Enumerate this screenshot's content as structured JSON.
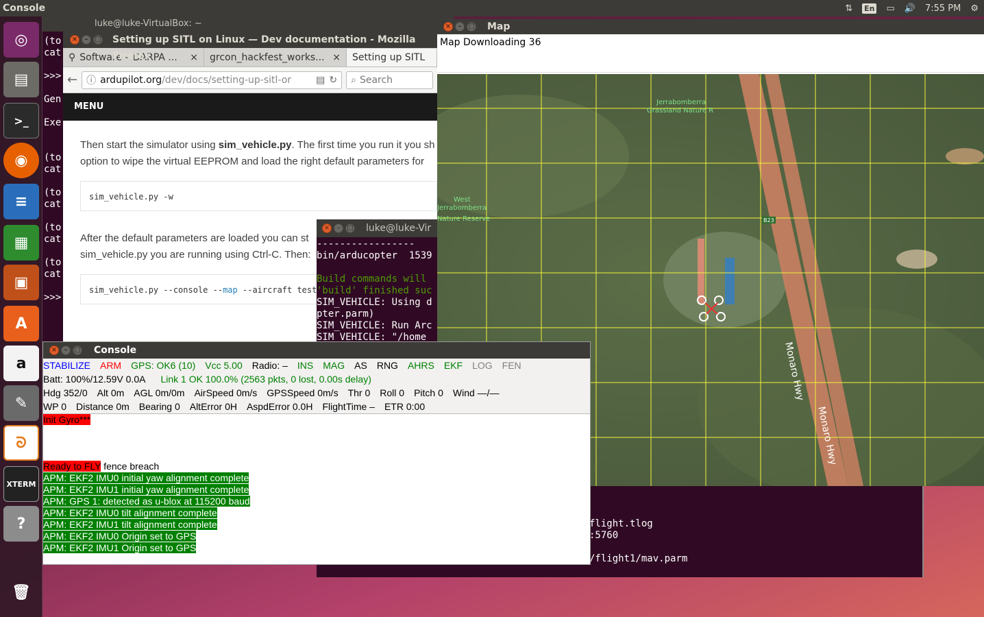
{
  "topbar": {
    "title": "Console",
    "lang": "En",
    "time": "7:55 PM"
  },
  "launcher": {
    "items": [
      "ubuntu-dash",
      "files",
      "terminal",
      "firefox",
      "libreoffice-writer",
      "libreoffice-calc",
      "libreoffice-impress",
      "software-center",
      "amazon",
      "system-settings",
      "mission-planner",
      "xterm",
      "help",
      "trash"
    ]
  },
  "bg_terminal": {
    "title": "luke@luke-VirtualBox: ~",
    "lines": [
      "(to",
      "cat",
      "",
      ">>>",
      "",
      "Gen",
      "",
      "Exe",
      "",
      "",
      "(to",
      "cat",
      "",
      "(to",
      "cat",
      "",
      "(to",
      "cat",
      "",
      "(to",
      "cat",
      "",
      ">>>"
    ]
  },
  "firefox": {
    "title": "Setting up SITL on Linux — Dev documentation - Mozilla Firefox",
    "tabs": [
      "Software – DARPA ...",
      "grcon_hackfest_works...",
      "Setting up SITL"
    ],
    "url_domain": "ardupilot.org",
    "url_path": "/dev/docs/setting-up-sitl-or",
    "search_placeholder": "Search",
    "menu": "MENU",
    "para1_a": "Then start the simulator using ",
    "para1_b": "sim_vehicle.py",
    "para1_c": ". The first time you run it you sh",
    "para1_line2": "option to wipe the virtual EEPROM and load the right default parameters for",
    "code1": "sim_vehicle.py -w",
    "para2_line1": "After the default parameters are loaded you can st",
    "para2_line2": "sim_vehicle.py you are running using Ctrl-C. Then:",
    "code2_a": "sim_vehicle.py --console --",
    "code2_map": "map",
    "code2_b": " --aircraft test"
  },
  "term2": {
    "title": "luke@luke-Vir",
    "lines": [
      "-----------------",
      "bin/arducopter  1539",
      "",
      "Build commands will",
      "'build' finished suc",
      "SIM_VEHICLE: Using d",
      "pter.parm)",
      "SIM_VEHICLE: Run Arc",
      "SIM_VEHICLE: \"/home"
    ]
  },
  "bottom_terminal": {
    "lines": [
      "flight.tlog",
      ":5760",
      "",
      "/flight1/mav.parm"
    ]
  },
  "map": {
    "title": "Map",
    "status": "Map Downloading 36",
    "labels": {
      "grassland_1": "Jerrabomberra",
      "grassland_2": "Grassland Nature R",
      "west_1": "West",
      "west_2": "Jerrabomberra",
      "west_3": "Nature Reserve",
      "road_badge": "B23",
      "hwy1": "Monaro Hwy",
      "hwy2": "Monaro Hwy"
    }
  },
  "console": {
    "title": "Console",
    "row1": [
      "STABILIZE",
      "ARM",
      "GPS: OK6 (10)",
      "Vcc 5.00",
      "Radio: –",
      "INS",
      "MAG",
      "AS",
      "RNG",
      "AHRS",
      "EKF",
      "LOG",
      "FEN"
    ],
    "row1_colors": [
      "#0000ff",
      "#ff0000",
      "#008000",
      "#008000",
      "#000000",
      "#008000",
      "#008000",
      "#000000",
      "#000000",
      "#008000",
      "#008000",
      "#808080",
      "#808080"
    ],
    "row2_batt": "Batt: 100%/12.59V 0.0A",
    "row2_link": "Link 1 OK 100.0% (2563 pkts, 0 lost, 0.00s delay)",
    "row3": [
      "Hdg 352/0",
      "Alt 0m",
      "AGL 0m/0m",
      "AirSpeed 0m/s",
      "GPSSpeed 0m/s",
      "Thr 0",
      "Roll 0",
      "Pitch 0",
      "Wind —/—"
    ],
    "row4": [
      "WP 0",
      "Distance 0m",
      "Bearing 0",
      "AltError 0H",
      "AspdError 0.0H",
      "FlightTime –",
      "ETR 0:00"
    ],
    "log_init": "Init Gyro***",
    "log_ready": "Ready to FLY",
    "log_fence": " fence breach",
    "log_lines": [
      "APM: EKF2 IMU0 initial yaw alignment complete",
      "APM: EKF2 IMU1 initial yaw alignment complete",
      "APM: GPS 1: detected as u-blox at 115200 baud",
      "APM: EKF2 IMU0 tilt alignment complete",
      "APM: EKF2 IMU1 tilt alignment complete",
      "APM: EKF2 IMU0 Origin set to GPS",
      "APM: EKF2 IMU1 Origin set to GPS"
    ]
  }
}
